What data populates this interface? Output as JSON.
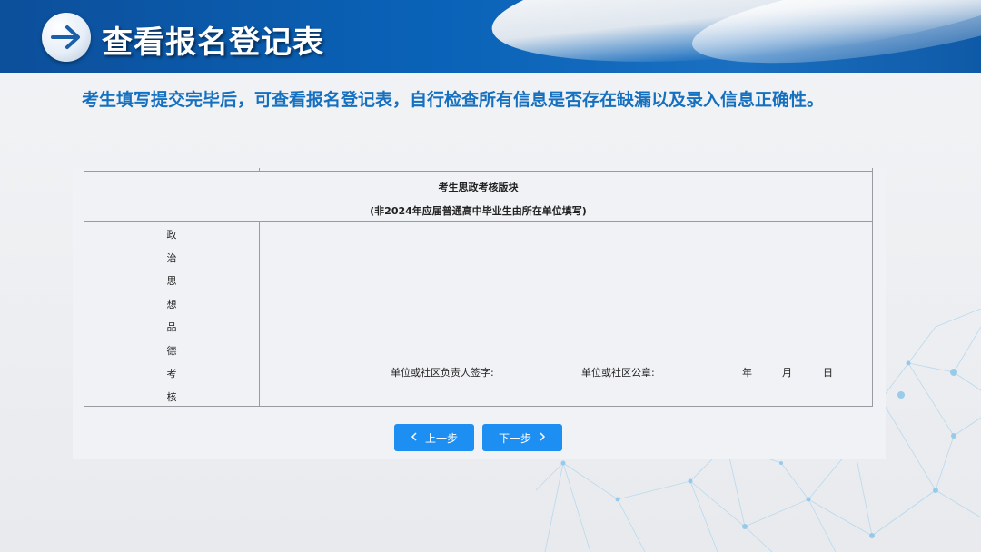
{
  "header": {
    "title": "查看报名登记表",
    "icon": "arrow-right-icon"
  },
  "instruction": "考生填写提交完毕后，可查看报名登记表，自行检查所有信息是否存在缺漏以及录入信息正确性。",
  "form": {
    "section_title": "考生思政考核版块",
    "section_subtitle": "(非2024年应届普通高中毕业生由所在单位填写)",
    "left_label_chars": [
      "政",
      "治",
      "思",
      "想",
      "品",
      "德",
      "考",
      "核"
    ],
    "signature_label": "单位或社区负责人签字:",
    "seal_label": "单位或社区公章:",
    "date_year": "年",
    "date_month": "月",
    "date_day": "日"
  },
  "buttons": {
    "prev_label": "上一步",
    "next_label": "下一步",
    "prev_icon": "chevron-left-icon",
    "next_icon": "chevron-right-icon"
  },
  "colors": {
    "header_blue": "#0a63b8",
    "instruction_blue": "#1670c0",
    "button_blue": "#1e8ff2"
  }
}
